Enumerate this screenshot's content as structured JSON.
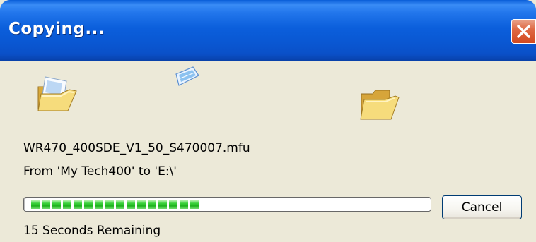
{
  "window": {
    "title": "Copying..."
  },
  "file": {
    "name": "WR470_400SDE_V1_50_S470007.mfu",
    "route": "From 'My Tech400' to 'E:\\'"
  },
  "progress": {
    "percent": 45,
    "status": "15 Seconds Remaining"
  },
  "buttons": {
    "cancel_label": "Cancel"
  },
  "icons": {
    "close": "close-icon",
    "source_folder": "open-folder-icon",
    "flying_document": "flying-document-icon",
    "destination_folder": "folder-icon"
  },
  "colors": {
    "titlebar": "#0a5ed8",
    "progress_fill": "#3cd23c",
    "dialog_background": "#ece9d8"
  }
}
